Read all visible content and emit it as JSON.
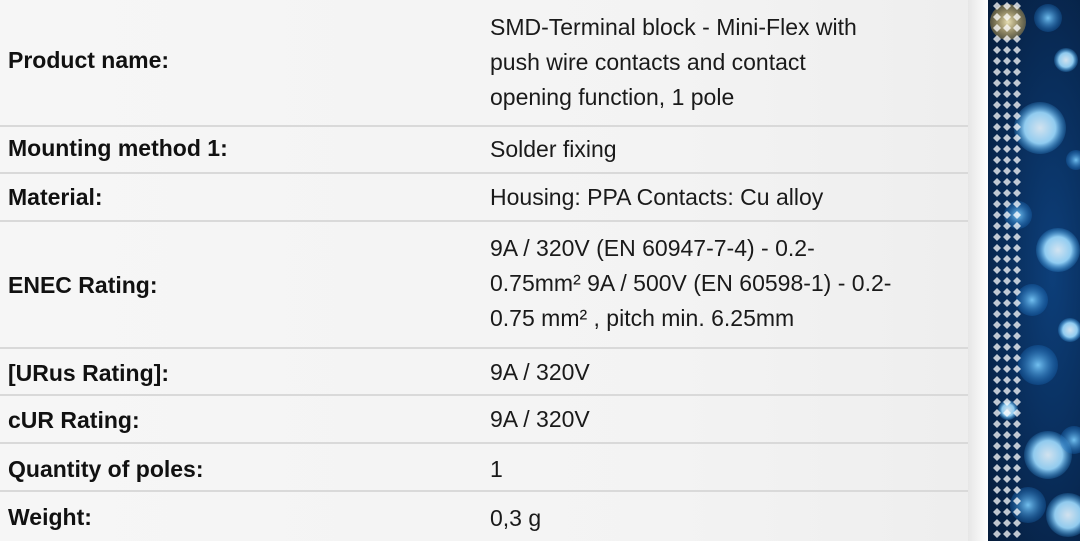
{
  "rows": [
    {
      "label": "Product name:",
      "value_lines": [
        "SMD-Terminal block - Mini-Flex with",
        "push wire contacts and contact",
        "opening function, 1 pole"
      ]
    },
    {
      "label": "Mounting method 1:",
      "value_lines": [
        "Solder fixing"
      ]
    },
    {
      "label": "Material:",
      "value_lines": [
        "Housing: PPA Contacts: Cu alloy"
      ]
    },
    {
      "label": "ENEC Rating:",
      "value_lines": [
        "9A / 320V (EN 60947-7-4) - 0.2-",
        "0.75mm² 9A / 500V (EN 60598-1) - 0.2-",
        "0.75 mm² , pitch min. 6.25mm"
      ]
    },
    {
      "label": "[URus Rating]:",
      "value_lines": [
        "9A / 320V"
      ]
    },
    {
      "label": "cUR Rating:",
      "value_lines": [
        "9A / 320V"
      ]
    },
    {
      "label": "Quantity of poles:",
      "value_lines": [
        "1"
      ]
    },
    {
      "label": "Weight:",
      "value_lines": [
        "0,3 g"
      ]
    }
  ],
  "decoration": {
    "dot_colors": [
      "#ffffff",
      "#bfe6ff",
      "#7fd0ff",
      "#3fa9f5",
      "#ffe08a"
    ]
  }
}
